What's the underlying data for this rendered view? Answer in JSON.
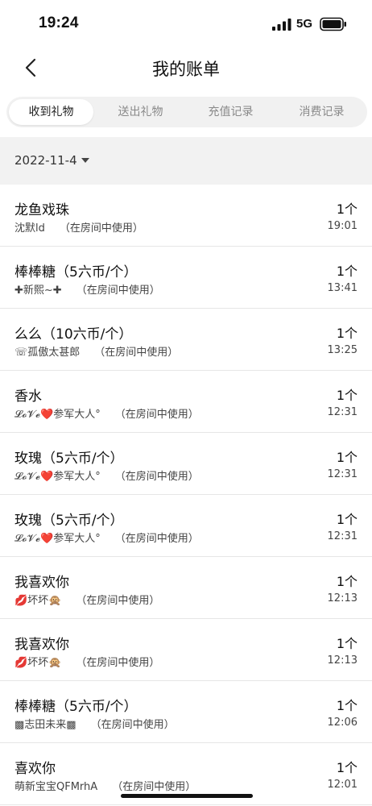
{
  "status_bar": {
    "time": "19:24",
    "network": "5G",
    "signal_icon": "signal-bars-icon",
    "battery_icon": "battery-icon"
  },
  "nav": {
    "title": "我的账单",
    "back_icon": "chevron-left-icon"
  },
  "tabs": [
    {
      "label": "收到礼物",
      "active": true
    },
    {
      "label": "送出礼物",
      "active": false
    },
    {
      "label": "充值记录",
      "active": false
    },
    {
      "label": "消费记录",
      "active": false
    }
  ],
  "date_filter": {
    "label": "2022-11-4",
    "icon": "caret-down-icon"
  },
  "records": [
    {
      "name": "龙鱼戏珠",
      "sender": "沈默ld",
      "usage": "（在房间中使用）",
      "qty": "1个",
      "time": "19:01"
    },
    {
      "name": "棒棒糖（5六币/个）",
      "sender": "✚新熙~✚",
      "usage": "（在房间中使用）",
      "qty": "1个",
      "time": "13:41"
    },
    {
      "name": "么么（10六币/个）",
      "sender": "☏孤傲太甚郎",
      "usage": "（在房间中使用）",
      "qty": "1个",
      "time": "13:25"
    },
    {
      "name": "香水",
      "sender": "𝓛𝓸𝓥𝓮❤️参军大人°",
      "usage": "（在房间中使用）",
      "qty": "1个",
      "time": "12:31"
    },
    {
      "name": "玫瑰（5六币/个）",
      "sender": "𝓛𝓸𝓥𝓮❤️参军大人°",
      "usage": "（在房间中使用）",
      "qty": "1个",
      "time": "12:31"
    },
    {
      "name": "玫瑰（5六币/个）",
      "sender": "𝓛𝓸𝓥𝓮❤️参军大人°",
      "usage": "（在房间中使用）",
      "qty": "1个",
      "time": "12:31"
    },
    {
      "name": "我喜欢你",
      "sender": "💋坏坏🙊",
      "usage": "（在房间中使用）",
      "qty": "1个",
      "time": "12:13"
    },
    {
      "name": "我喜欢你",
      "sender": "💋坏坏🙊",
      "usage": "（在房间中使用）",
      "qty": "1个",
      "time": "12:13"
    },
    {
      "name": "棒棒糖（5六币/个）",
      "sender": "▩志田未来▩",
      "usage": "（在房间中使用）",
      "qty": "1个",
      "time": "12:06"
    },
    {
      "name": "喜欢你",
      "sender": "萌新宝宝QFMrhA",
      "usage": "（在房间中使用）",
      "qty": "1个",
      "time": "12:01"
    }
  ]
}
